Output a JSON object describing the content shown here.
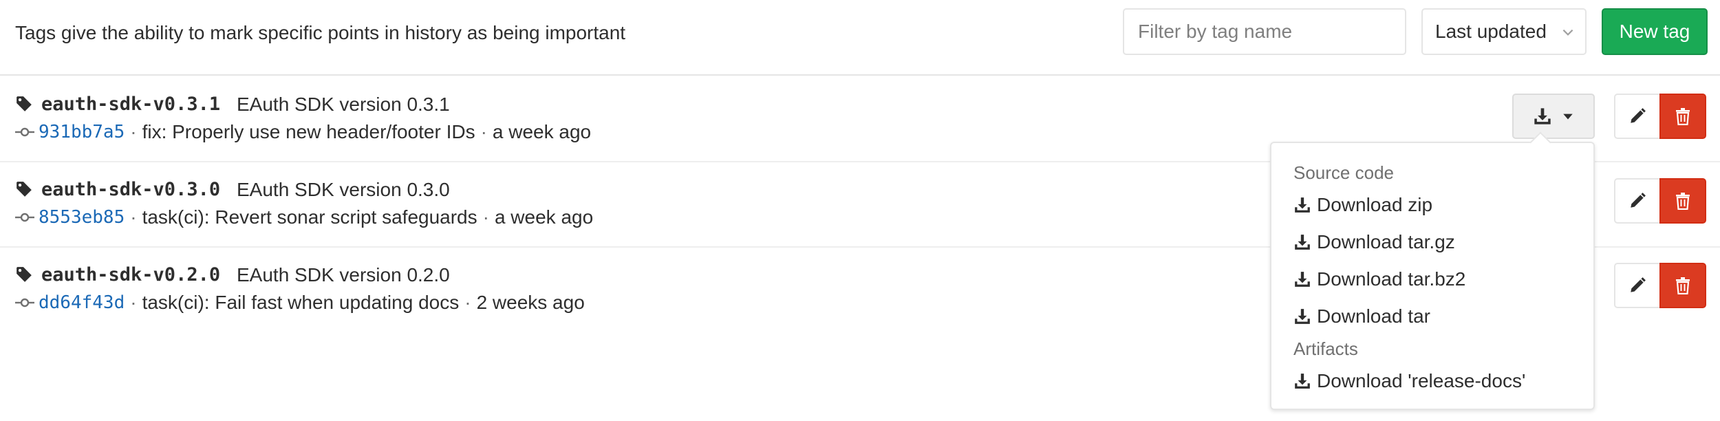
{
  "header": {
    "description": "Tags give the ability to mark specific points in history as being important",
    "filter": {
      "placeholder": "Filter by tag name",
      "value": ""
    },
    "sort": {
      "selected": "Last updated"
    },
    "new_tag_label": "New tag"
  },
  "tags": [
    {
      "name": "eauth-sdk-v0.3.1",
      "message": "EAuth SDK version 0.3.1",
      "sha": "931bb7a5",
      "commit_title": "fix: Properly use new header/footer IDs",
      "time": "a week ago"
    },
    {
      "name": "eauth-sdk-v0.3.0",
      "message": "EAuth SDK version 0.3.0",
      "sha": "8553eb85",
      "commit_title": "task(ci): Revert sonar script safeguards",
      "time": "a week ago"
    },
    {
      "name": "eauth-sdk-v0.2.0",
      "message": "EAuth SDK version 0.2.0",
      "sha": "dd64f43d",
      "commit_title": "task(ci): Fail fast when updating docs",
      "time": "2 weeks ago"
    }
  ],
  "separator": "·",
  "download_menu": {
    "source_header": "Source code",
    "source_items": [
      "Download zip",
      "Download tar.gz",
      "Download tar.bz2",
      "Download tar"
    ],
    "artifacts_header": "Artifacts",
    "artifact_items": [
      "Download 'release-docs'"
    ]
  },
  "icons": {
    "tag": "tag-icon",
    "commit": "commit-icon",
    "download": "download-icon",
    "caret": "caret-down-icon",
    "edit": "pencil-icon",
    "delete": "trash-icon"
  },
  "colors": {
    "primary_green": "#1aaa55",
    "danger_red": "#db3b21",
    "link_blue": "#1b69b6"
  }
}
